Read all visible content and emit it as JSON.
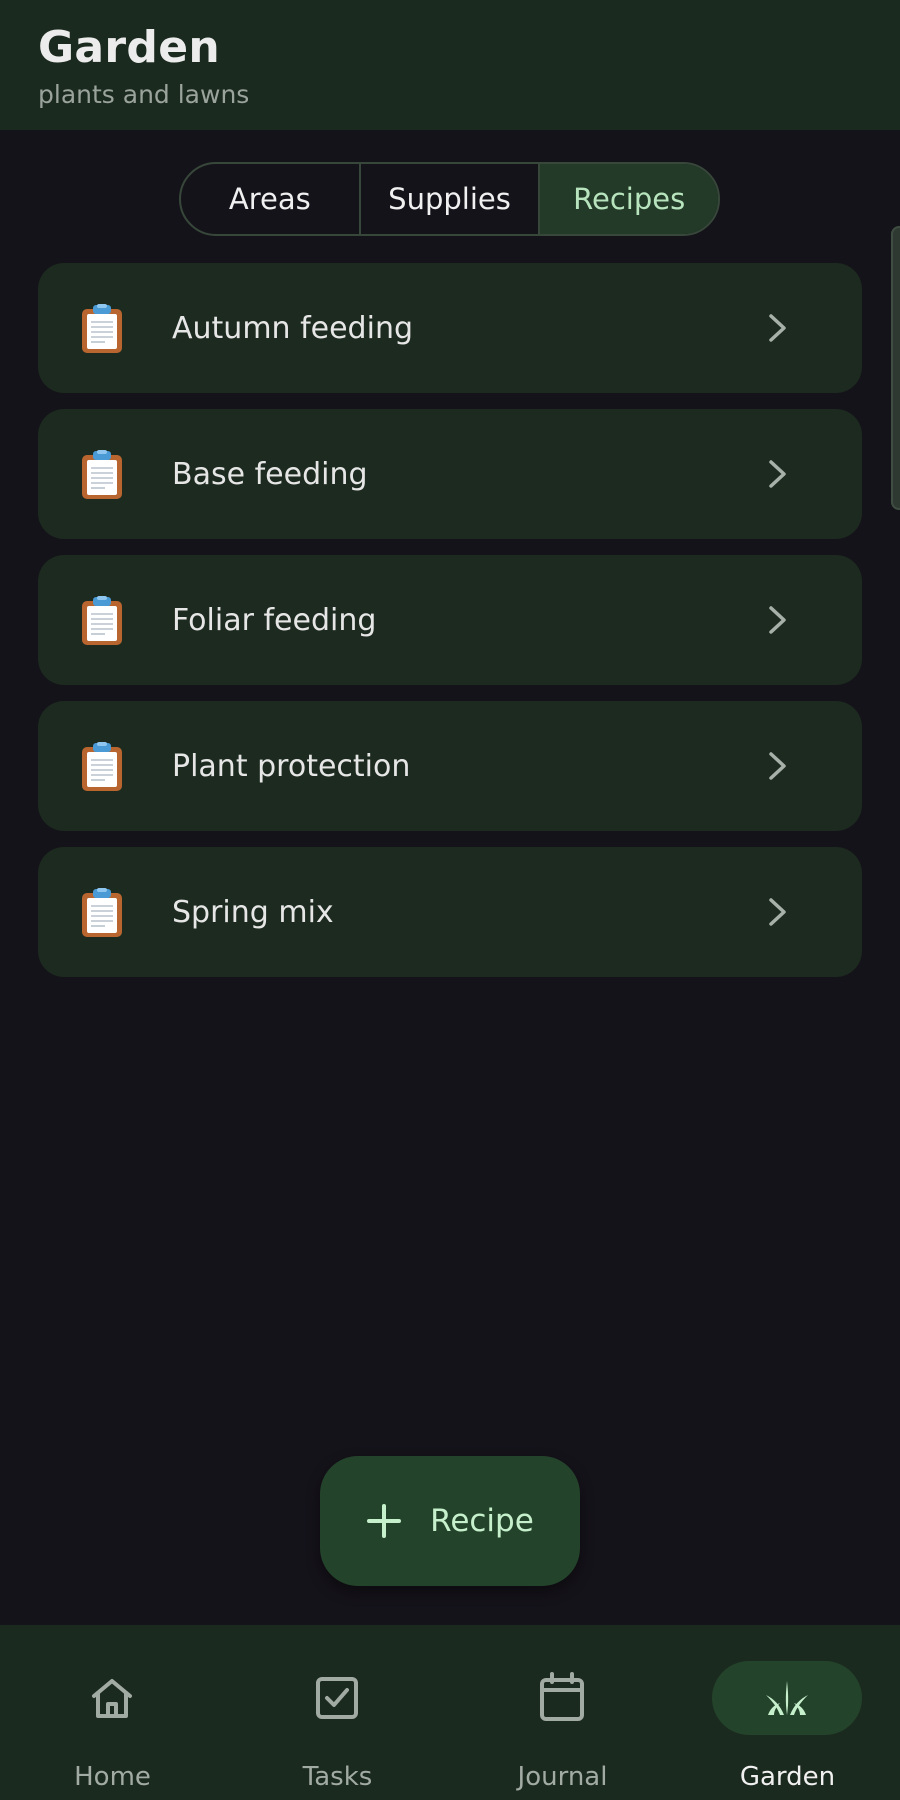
{
  "header": {
    "title": "Garden",
    "subtitle": "plants and lawns"
  },
  "tabs": [
    {
      "label": "Areas",
      "active": false
    },
    {
      "label": "Supplies",
      "active": false
    },
    {
      "label": "Recipes",
      "active": true
    }
  ],
  "recipes": [
    {
      "label": "Autumn feeding",
      "icon": "clipboard-icon"
    },
    {
      "label": "Base feeding",
      "icon": "clipboard-icon"
    },
    {
      "label": "Foliar feeding",
      "icon": "clipboard-icon"
    },
    {
      "label": "Plant protection",
      "icon": "clipboard-icon"
    },
    {
      "label": "Spring mix",
      "icon": "clipboard-icon"
    }
  ],
  "fab": {
    "label": "Recipe",
    "icon": "plus-icon"
  },
  "nav": [
    {
      "label": "Home",
      "icon": "home-icon",
      "active": false
    },
    {
      "label": "Tasks",
      "icon": "tasks-icon",
      "active": false
    },
    {
      "label": "Journal",
      "icon": "calendar-icon",
      "active": false
    },
    {
      "label": "Garden",
      "icon": "grass-icon",
      "active": true
    }
  ],
  "colors": {
    "background": "#15131a",
    "surface": "#1c2a1f",
    "accent": "#24432b",
    "accent_text": "#b7e3bd"
  }
}
